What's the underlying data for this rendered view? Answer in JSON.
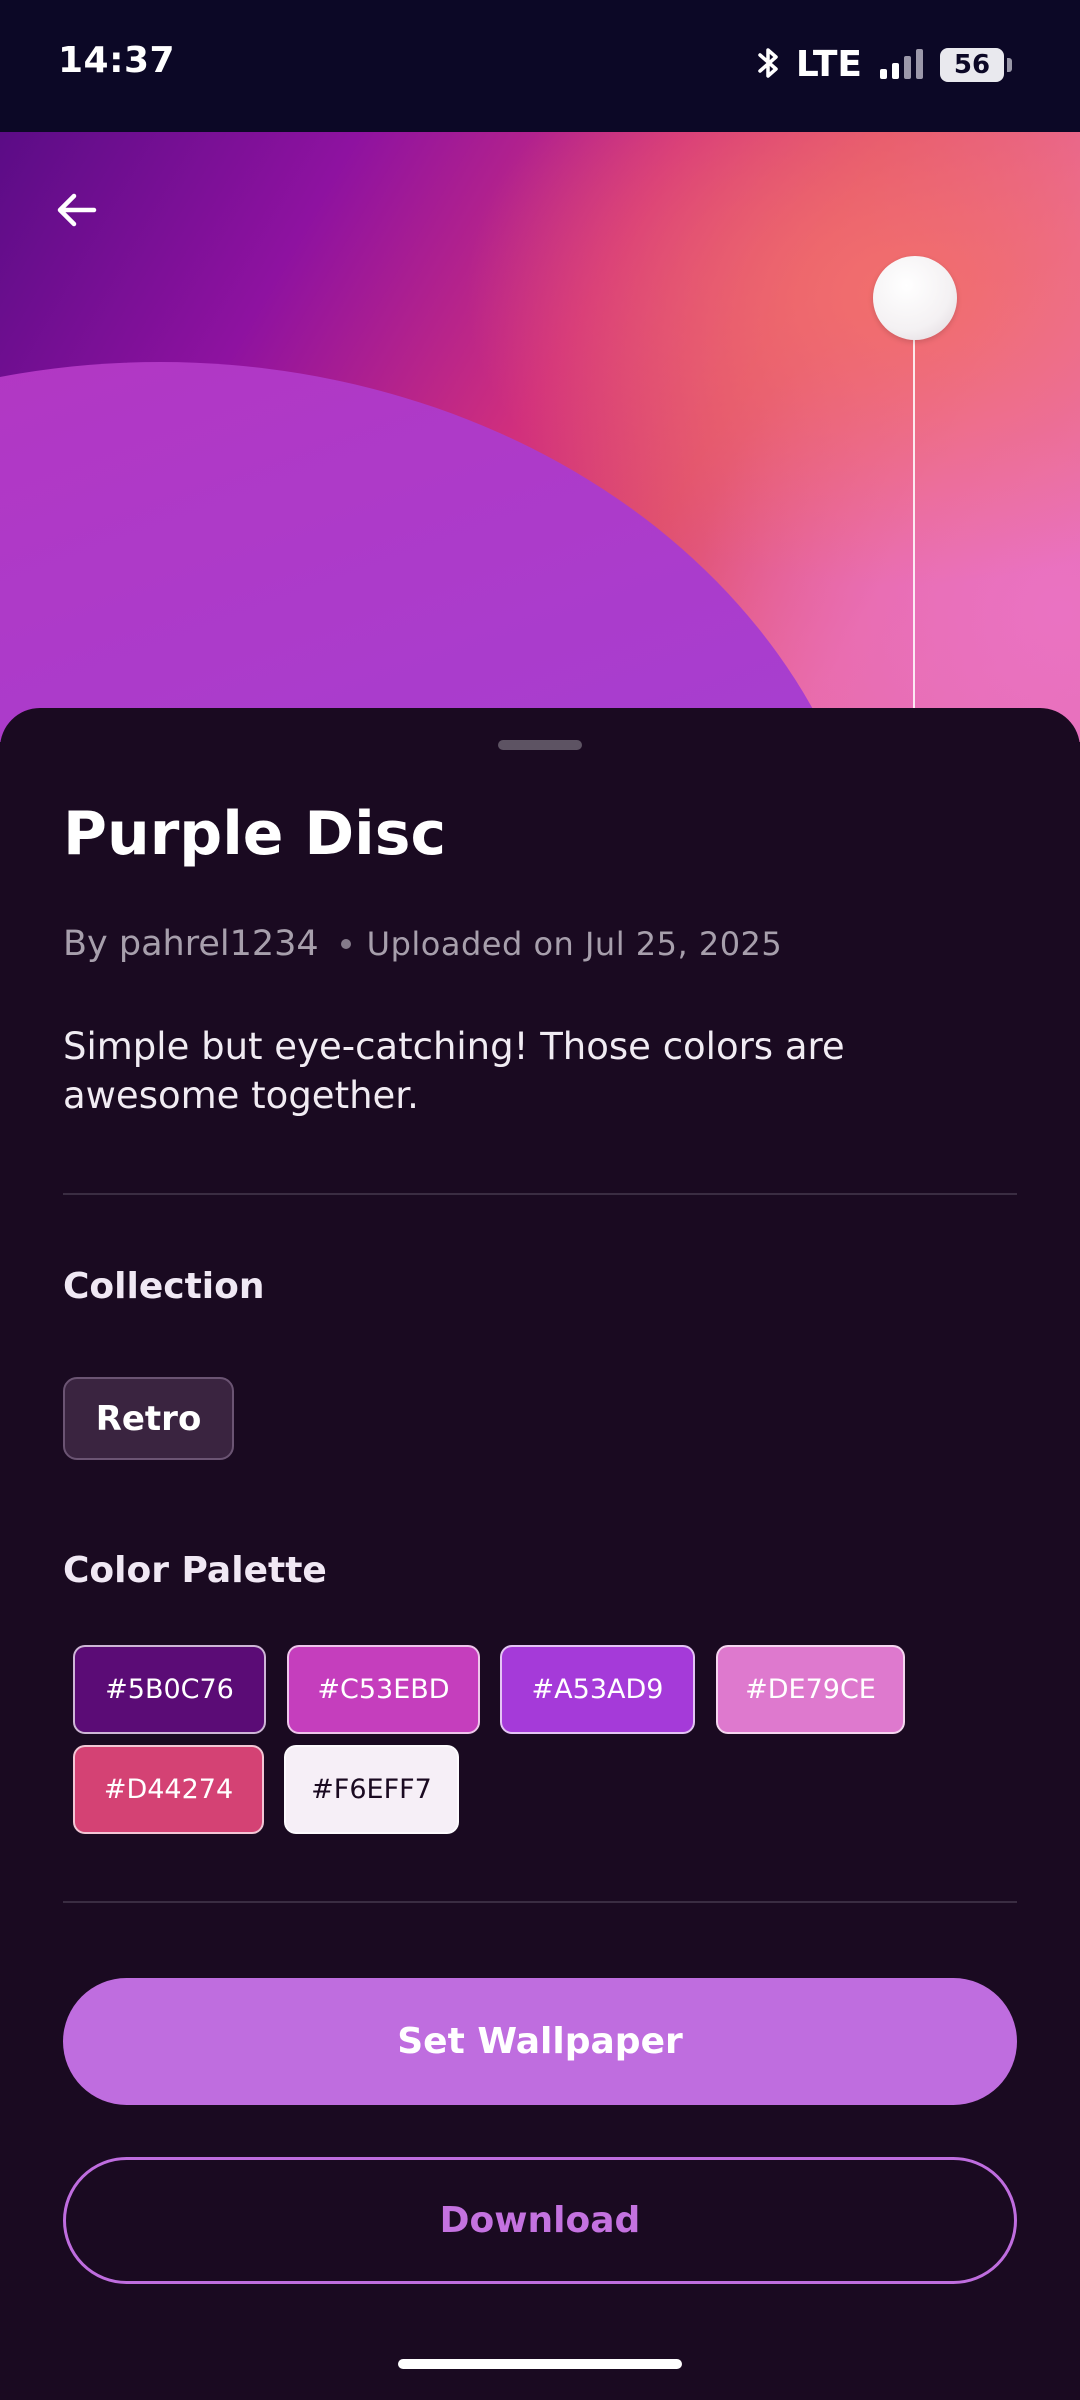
{
  "status_bar": {
    "time": "14:37",
    "network": "LTE",
    "battery": "56",
    "icons": [
      "bluetooth-icon",
      "signal-icon",
      "battery-icon"
    ]
  },
  "header": {
    "back_icon": "arrow-left-icon"
  },
  "wallpaper": {
    "title": "Purple Disc",
    "author": "By pahrel1234",
    "uploaded": "Uploaded on Jul 25, 2025",
    "description": "Simple but eye-catching! Those colors are awesome together."
  },
  "collection": {
    "heading": "Collection",
    "chip": "Retro"
  },
  "palette": {
    "heading": "Color Palette",
    "colors": [
      {
        "hex": "#5B0C76",
        "text_color": "#ffffff"
      },
      {
        "hex": "#C53EBD",
        "text_color": "#ffffff"
      },
      {
        "hex": "#A53AD9",
        "text_color": "#ffffff"
      },
      {
        "hex": "#DE79CE",
        "text_color": "#ffffff"
      },
      {
        "hex": "#D44274",
        "text_color": "#ffffff"
      },
      {
        "hex": "#F6EFF7",
        "text_color": "#1a0a21"
      }
    ]
  },
  "actions": {
    "set_wallpaper": "Set Wallpaper",
    "download": "Download"
  },
  "colors": {
    "accent": "#BF6DDF",
    "background": "#1A0A21",
    "status_bar": "#0C0826"
  }
}
